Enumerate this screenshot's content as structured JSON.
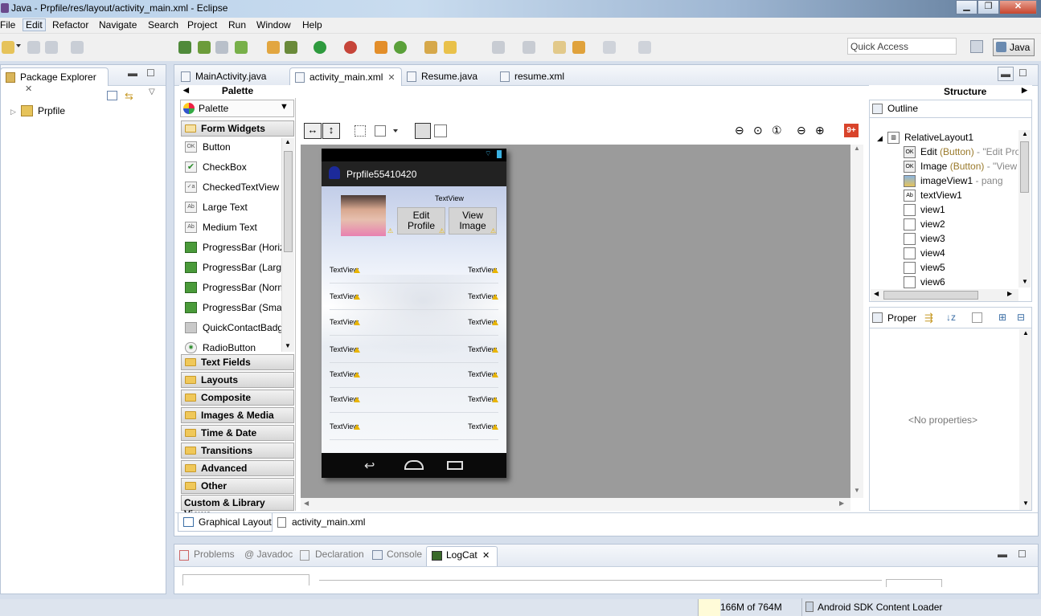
{
  "window": {
    "title": "Java - Prpfile/res/layout/activity_main.xml - Eclipse",
    "minimize": "▁",
    "maximize": "❐",
    "close": "✕"
  },
  "menu": [
    "File",
    "Edit",
    "Refactor",
    "Navigate",
    "Search",
    "Project",
    "Run",
    "Window",
    "Help"
  ],
  "toolbar": {
    "quick_access_placeholder": "Quick Access",
    "perspective": "Java"
  },
  "package_explorer": {
    "title": "Package Explorer",
    "project": "Prpfile"
  },
  "editor_tabs": [
    {
      "label": "MainActivity.java",
      "active": false
    },
    {
      "label": "activity_main.xml",
      "active": true
    },
    {
      "label": "Resume.java",
      "active": false
    },
    {
      "label": "resume.xml",
      "active": false
    }
  ],
  "palette": {
    "header": "Palette",
    "dropdown": "Palette",
    "open_category": "Form Widgets",
    "widgets": [
      {
        "label": "Button",
        "icon": "OK"
      },
      {
        "label": "CheckBox",
        "icon": "✔"
      },
      {
        "label": "CheckedTextView",
        "icon": "✓a"
      },
      {
        "label": "Large Text",
        "icon": "Ab"
      },
      {
        "label": "Medium Text",
        "icon": "Ab"
      },
      {
        "label": "ProgressBar (Horiz",
        "icon": ""
      },
      {
        "label": "ProgressBar (Large",
        "icon": ""
      },
      {
        "label": "ProgressBar (Norm",
        "icon": ""
      },
      {
        "label": "ProgressBar (Small",
        "icon": ""
      },
      {
        "label": "QuickContactBadg",
        "icon": ""
      },
      {
        "label": "RadioButton",
        "icon": "◉"
      }
    ],
    "categories": [
      "Text Fields",
      "Layouts",
      "Composite",
      "Images & Media",
      "Time & Date",
      "Transitions",
      "Advanced",
      "Other",
      "Custom & Library Views"
    ]
  },
  "device": {
    "app_title": "Prpfile55410420",
    "textview_top": "TextView",
    "edit_button": "Edit Profile",
    "view_button": "View Image",
    "rows": [
      {
        "left": "TextView",
        "right": "TextView"
      },
      {
        "left": "TextView",
        "right": "TextView"
      },
      {
        "left": "TextView",
        "right": "TextView"
      },
      {
        "left": "TextView",
        "right": "TextView"
      },
      {
        "left": "TextView",
        "right": "TextView"
      },
      {
        "left": "TextView",
        "right": "TextView"
      },
      {
        "left": "TextView",
        "right": "TextView"
      }
    ]
  },
  "lint_badge": "9+",
  "layout_tabs": [
    "Graphical Layout",
    "activity_main.xml"
  ],
  "structure": {
    "header": "Structure",
    "outline_title": "Outline",
    "root": "RelativeLayout1",
    "items": [
      {
        "name": "Edit",
        "type": " (Button)",
        "desc": " - \"Edit Pro",
        "icon": "OK"
      },
      {
        "name": "Image",
        "type": " (Button)",
        "desc": " - \"View",
        "icon": "OK"
      },
      {
        "name": "imageView1",
        "type": "",
        "desc": " - pang",
        "icon": "img"
      },
      {
        "name": "textView1",
        "type": "",
        "desc": "",
        "icon": "Ab"
      },
      {
        "name": "view1",
        "type": "",
        "desc": "",
        "icon": ""
      },
      {
        "name": "view2",
        "type": "",
        "desc": "",
        "icon": ""
      },
      {
        "name": "view3",
        "type": "",
        "desc": "",
        "icon": ""
      },
      {
        "name": "view4",
        "type": "",
        "desc": "",
        "icon": ""
      },
      {
        "name": "view5",
        "type": "",
        "desc": "",
        "icon": ""
      },
      {
        "name": "view6",
        "type": "",
        "desc": "",
        "icon": ""
      }
    ],
    "properties_title": "Proper",
    "no_properties": "<No properties>"
  },
  "bottom_tabs": [
    {
      "label": "Problems",
      "active": false
    },
    {
      "label": "@ Javadoc",
      "active": false
    },
    {
      "label": "Declaration",
      "active": false
    },
    {
      "label": "Console",
      "active": false
    },
    {
      "label": "LogCat",
      "active": true
    }
  ],
  "status": {
    "memory": "166M of 764M",
    "task": "Android SDK Content Loader"
  },
  "colors": {
    "accent": "#3b6ea5",
    "lint": "#d9442b"
  }
}
